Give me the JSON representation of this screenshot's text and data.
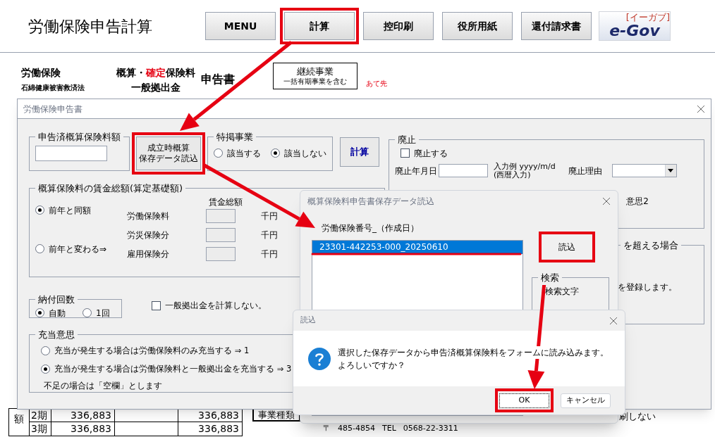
{
  "header": {
    "title": "労働保険申告計算",
    "toolbar": [
      {
        "label": "MENU",
        "highlighted": false
      },
      {
        "label": "計算",
        "highlighted": true
      },
      {
        "label": "控印刷",
        "highlighted": false
      },
      {
        "label": "役所用紙",
        "highlighted": false
      },
      {
        "label": "還付請求書",
        "highlighted": false
      }
    ],
    "logo": {
      "text": "e-Gov",
      "ruby": "[イーガブ]"
    }
  },
  "sheet": {
    "law_title": "労働保険",
    "law_subtitle": "石綿健康被害救済法",
    "form_title_parts": [
      {
        "text": "概算・",
        "accent": false
      },
      {
        "text": "確定",
        "accent": true
      },
      {
        "text": "保険料",
        "accent": false
      }
    ],
    "form_subtitle": "一般拠出金",
    "form_suffix": "申告書",
    "business_box": {
      "title": "継続事業",
      "note": "一括有期事業を含む"
    },
    "address_label": "あて先",
    "table": {
      "side_label": "額",
      "rows": [
        {
          "period": "2期",
          "column_2": "336,883",
          "column_4": "336,883"
        },
        {
          "period": "3期",
          "column_2": "336,883",
          "column_4": "336,883"
        }
      ]
    },
    "business_type": "事業種類",
    "postal_mark": "〒",
    "postal_code": "485-4854",
    "tel_label": "TEL",
    "tel": "0568-22-3311",
    "print_note": "刷しない"
  },
  "main_dialog": {
    "title": "労働保険申告書",
    "declared_group": {
      "legend": "申告済概算保険料額"
    },
    "load_button": {
      "lines": [
        "成立時概算",
        "保存データ読込"
      ],
      "highlighted": true
    },
    "special_group": {
      "legend": "特掲事業",
      "options": [
        {
          "label": "該当する",
          "selected": false
        },
        {
          "label": "該当しない",
          "selected": true
        }
      ]
    },
    "calc_button": "計算",
    "wage_group": {
      "legend": "概算保険料の賃金総額(算定基礎額)",
      "column_header": "賃金総額",
      "options": [
        {
          "label": "前年と同額",
          "selected": true
        },
        {
          "label": "前年と変わる⇒",
          "selected": false
        }
      ],
      "rows": [
        {
          "label": "労働保険料",
          "unit": "千円"
        },
        {
          "label": "労災保険分",
          "unit": "千円"
        },
        {
          "label": "雇用保険分",
          "unit": "千円"
        }
      ]
    },
    "payment_group": {
      "legend": "納付回数",
      "options": [
        {
          "label": "自動",
          "selected": true
        },
        {
          "label": "1回",
          "selected": false
        }
      ]
    },
    "skip_levy": {
      "label": "一般拠出金を計算しない。",
      "checked": false
    },
    "allocation_group": {
      "legend": "充当意思",
      "options": [
        {
          "label": "充当が発生する場合は労働保険料のみ充当する ⇒ 1",
          "selected": false
        },
        {
          "label": "充当が発生する場合は労働保険料と一般拠出金を充当する ⇒ 3",
          "selected": true
        }
      ],
      "note": "不足の場合は「空欄」とします"
    },
    "abolish_group": {
      "legend": "廃止",
      "checkbox": {
        "label": "廃止する",
        "checked": false
      },
      "date_label": "廃止年月日",
      "example_line_1": "入力例 yyyy/m/d",
      "example_line_2": "(西暦入力)",
      "reason_label": "廃止理由",
      "hidden_text": "意思2"
    },
    "partial_group": {
      "legend": "を超える場合",
      "text": "を登録します。"
    }
  },
  "load_dialog": {
    "title": "概算保険料申告書保存データ読込",
    "list_label": "労働保険番号_（作成日）",
    "items": [
      {
        "text": "23301-442253-000_20250610",
        "selected": true
      }
    ],
    "read_button": {
      "label": "読込",
      "highlighted": true
    },
    "search_group": {
      "legend": "検索",
      "label": "検索文字"
    }
  },
  "message_box": {
    "title": "読込",
    "lines": [
      "選択した保存データから申告済概算保険料をフォームに読み込みます。",
      "よろしいですか？"
    ],
    "buttons": [
      {
        "label": "OK",
        "highlighted": true,
        "default": true
      },
      {
        "label": "キャンセル",
        "highlighted": false,
        "default": false
      }
    ]
  }
}
